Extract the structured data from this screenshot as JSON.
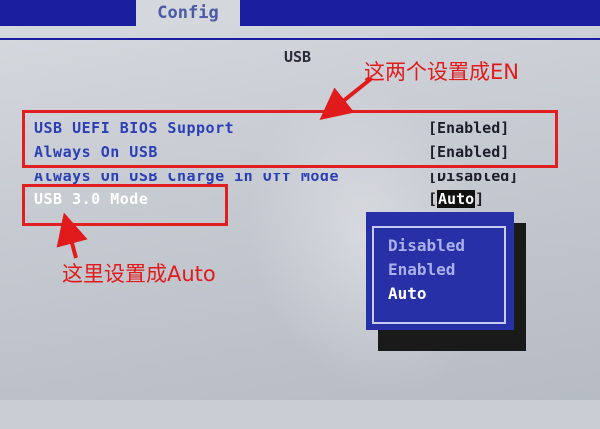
{
  "header": {
    "active_tab": "Config"
  },
  "page": {
    "title": "USB"
  },
  "settings": [
    {
      "label": "USB UEFI BIOS Support",
      "value": "[Enabled]"
    },
    {
      "label": "Always On USB",
      "value": "[Enabled]"
    },
    {
      "label": "Always On USB Charge in Off Mode",
      "value": "[Disabled]"
    },
    {
      "label": "USB 3.0 Mode",
      "value_prefix": "[",
      "value_selected": "Auto",
      "value_suffix": "]"
    }
  ],
  "popup": {
    "options": [
      "Disabled",
      "Enabled",
      "Auto"
    ],
    "selected": "Auto"
  },
  "annotations": {
    "top": "这两个设置成EN",
    "bottom": "这里设置成Auto",
    "color": "#e11b1b"
  },
  "colors": {
    "bios_blue": "#1a1fa0",
    "label_blue": "#2b3fb5",
    "highlight_red": "#e02020"
  }
}
